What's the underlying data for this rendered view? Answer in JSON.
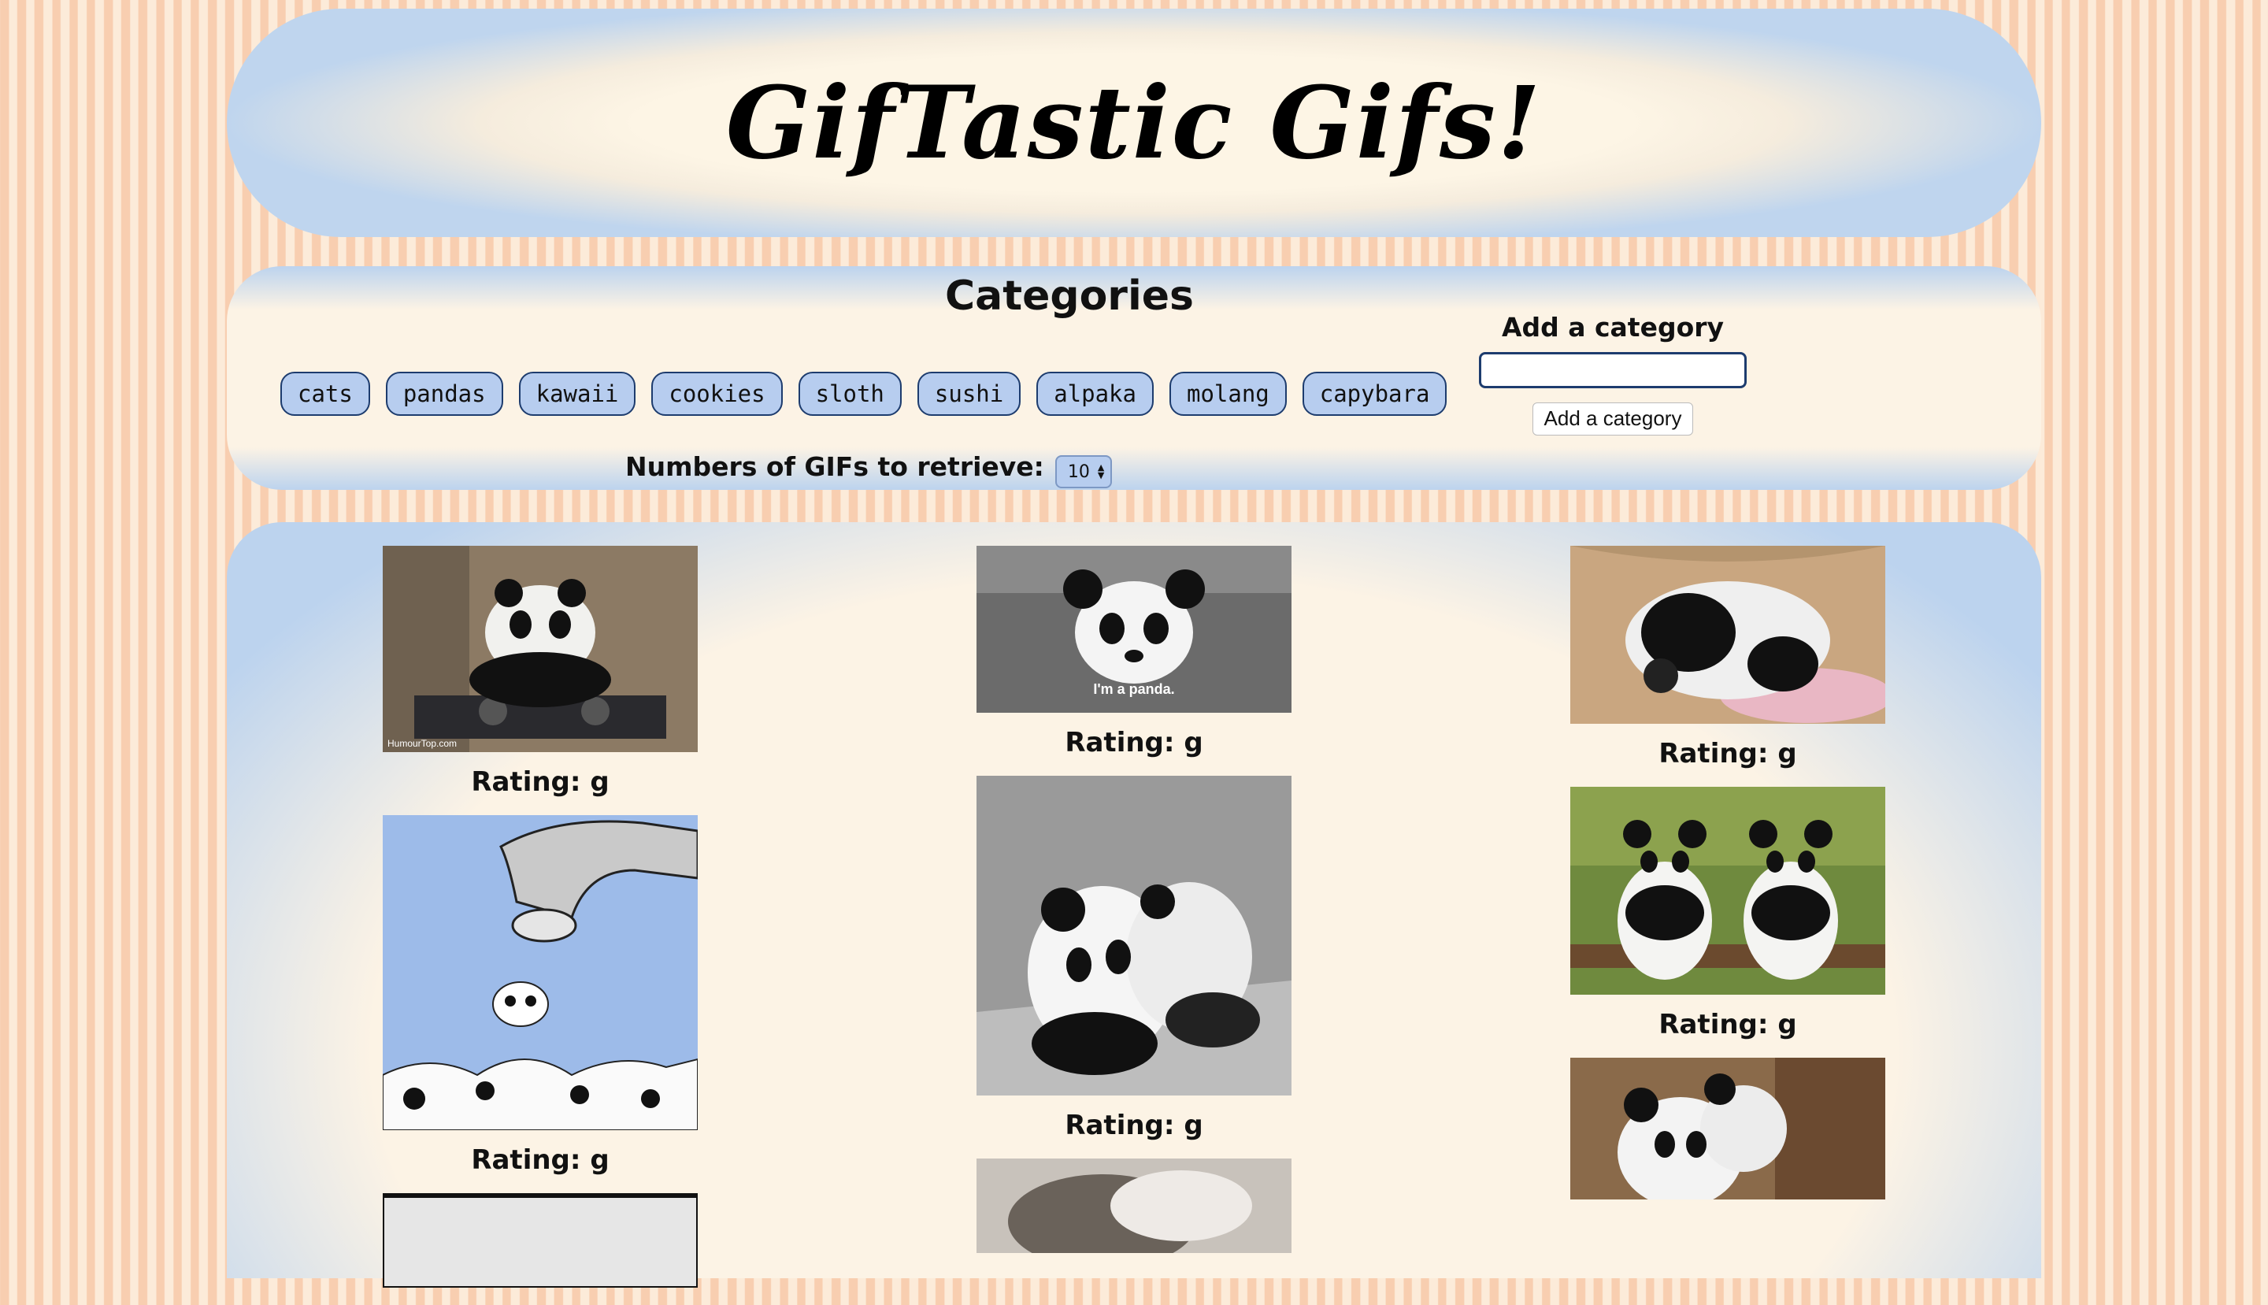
{
  "header": {
    "title": "GifTastic Gifs!"
  },
  "categories": {
    "heading": "Categories",
    "buttons": [
      "cats",
      "pandas",
      "kawaii",
      "cookies",
      "sloth",
      "sushi",
      "alpaka",
      "molang",
      "capybara"
    ],
    "retrieve_label": "Numbers of GIFs to retrieve:",
    "retrieve_value": "10"
  },
  "add_category": {
    "label": "Add a category",
    "input_value": "",
    "button_label": "Add a category"
  },
  "gifs": {
    "col1": [
      {
        "rating": "Rating: g",
        "caption": "HumourTop.com",
        "theme": "panda-dj"
      },
      {
        "rating": "Rating: g",
        "caption": "",
        "theme": "panda-faucet"
      },
      {
        "rating": "",
        "caption": "",
        "theme": "partial"
      }
    ],
    "col2": [
      {
        "rating": "Rating: g",
        "caption": "I'm a panda.",
        "theme": "panda-face"
      },
      {
        "rating": "Rating: g",
        "caption": "",
        "theme": "panda-hug"
      },
      {
        "rating": "",
        "caption": "",
        "theme": "partial"
      }
    ],
    "col3": [
      {
        "rating": "Rating: g",
        "caption": "",
        "theme": "panda-basket"
      },
      {
        "rating": "Rating: g",
        "caption": "",
        "theme": "panda-duo"
      },
      {
        "rating": "",
        "caption": "",
        "theme": "partial"
      }
    ]
  }
}
